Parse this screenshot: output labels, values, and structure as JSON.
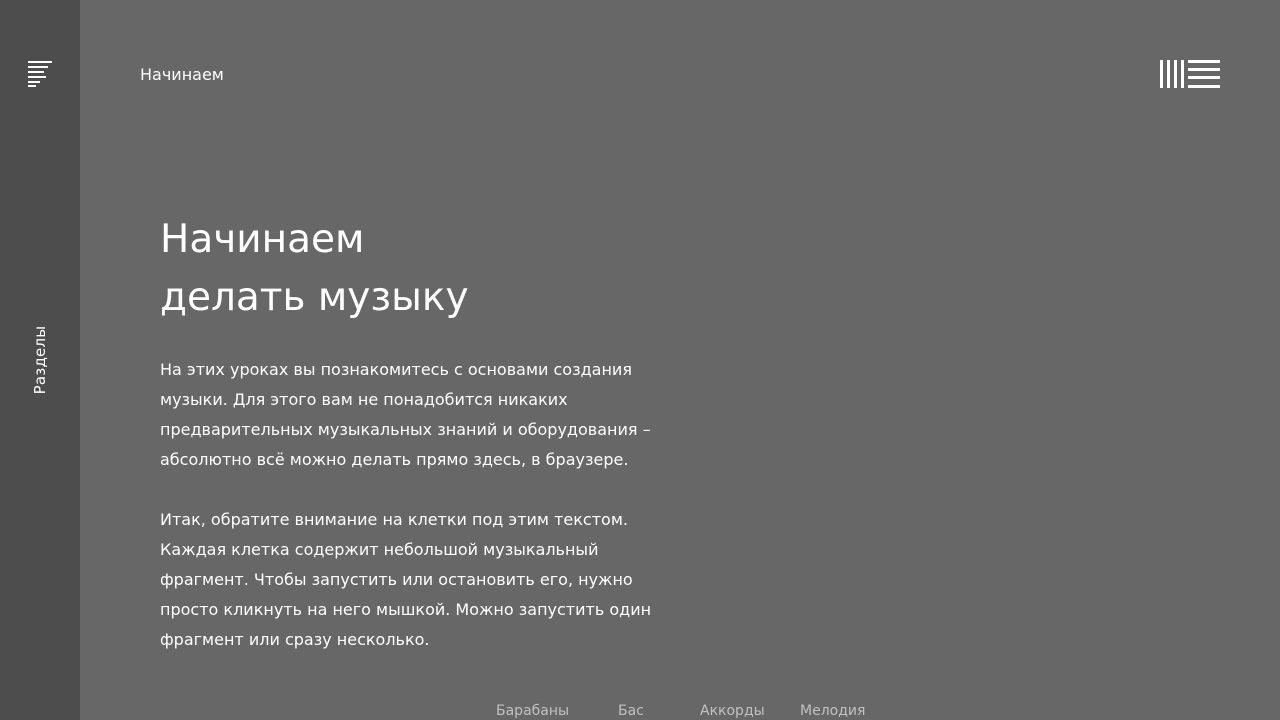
{
  "sidebar": {
    "menu_icon": "menu-lines-icon",
    "sections_label": "Разделы"
  },
  "header": {
    "title": "Начинаем",
    "logo_icon": "ableton-logo-icon"
  },
  "hero": {
    "title_line1": "Начинаем",
    "title_line2": "делать музыку"
  },
  "intro": {
    "paragraph1": [
      "На этих уроках вы познакомитесь с основами создания",
      "музыки. Для этого вам не понадобится никаких",
      "предварительных музыкальных знаний и оборудования –",
      "абсолютно всё можно делать прямо здесь, в браузере."
    ],
    "paragraph2": [
      "Итак, обратите внимание на клетки под этим текстом.",
      "Каждая клетка содержит небольшой музыкальный",
      "фрагмент. Чтобы запустить или остановить его, нужно",
      "просто кликнуть на него мышкой. Можно запустить один",
      "фрагмент или сразу несколько."
    ]
  },
  "tracks": {
    "drums": "Барабаны",
    "bass": "Бас",
    "chords": "Аккорды",
    "melody": "Мелодия"
  },
  "colors": {
    "background": "#676767",
    "sidebar": "#4d4d4d",
    "text": "#ffffff",
    "muted_text": "#c1c1c1"
  }
}
